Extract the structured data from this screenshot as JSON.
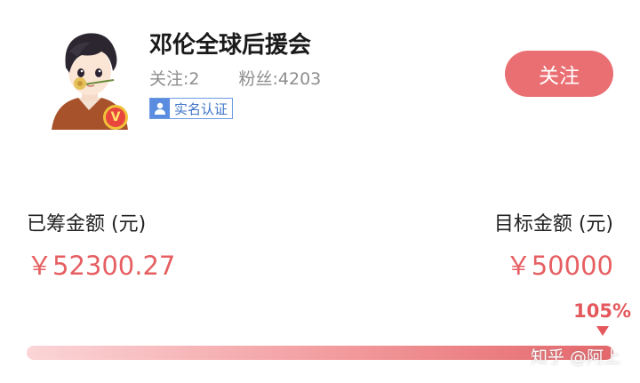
{
  "profile": {
    "name": "邓伦全球后援会",
    "following": "关注:2",
    "fans": "粉丝:4203",
    "verification": "实名认证",
    "vip_badge": "V",
    "avatar_icon": "cartoon-avatar-with-flower"
  },
  "actions": {
    "follow_label": "关注"
  },
  "funding": {
    "raised_label": "已筹金额 (元)",
    "raised_value": "￥52300.27",
    "target_label": "目标金额 (元)",
    "target_value": "￥50000",
    "percent_label": "105%",
    "progress_fraction": 1.0
  },
  "watermark": "知乎 @阿上",
  "colors": {
    "accent": "#ea6f73",
    "amount": "#e65f62",
    "verify_blue": "#5a8ddf"
  }
}
